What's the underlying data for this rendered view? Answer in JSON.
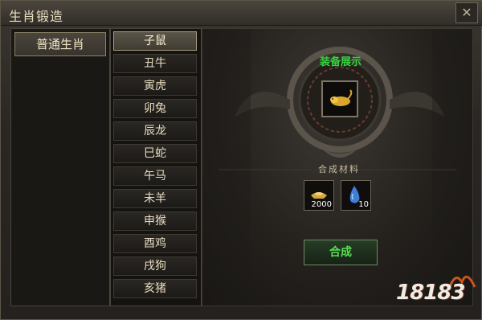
{
  "window": {
    "title": "生肖锻造",
    "close_label": "✕"
  },
  "category": {
    "label": "普通生肖"
  },
  "zodiac_list": [
    {
      "label": "子鼠",
      "selected": true
    },
    {
      "label": "丑牛"
    },
    {
      "label": "寅虎"
    },
    {
      "label": "卯兔"
    },
    {
      "label": "辰龙"
    },
    {
      "label": "巳蛇"
    },
    {
      "label": "午马"
    },
    {
      "label": "未羊"
    },
    {
      "label": "申猴"
    },
    {
      "label": "酉鸡"
    },
    {
      "label": "戌狗"
    },
    {
      "label": "亥猪"
    }
  ],
  "showcase": {
    "label": "装备展示",
    "item_icon": "golden-rat-icon"
  },
  "materials": {
    "label": "合成材料",
    "items": [
      {
        "icon": "gold-ingot-icon",
        "count": "2000"
      },
      {
        "icon": "blue-drop-icon",
        "count": "10"
      }
    ]
  },
  "actions": {
    "combine_label": "合成"
  },
  "watermark": {
    "text": "18183"
  },
  "colors": {
    "accent_green": "#35d23f",
    "text_gold": "#e8dcc0"
  }
}
